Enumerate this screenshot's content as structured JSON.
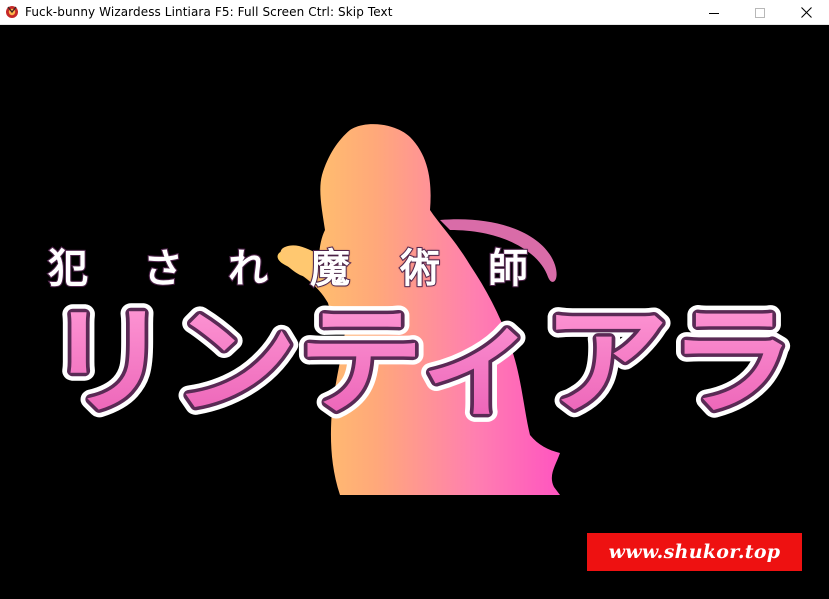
{
  "window": {
    "title": "Fuck-bunny Wizardess Lintiara F5: Full Screen Ctrl: Skip Text",
    "icon": "app-icon",
    "controls": {
      "minimize_icon": "minimize-icon",
      "maximize_icon": "maximize-icon",
      "close_icon": "close-icon"
    }
  },
  "game": {
    "subtitle": {
      "chars": [
        "犯",
        "さ",
        "れ",
        "魔",
        "術",
        "師"
      ]
    },
    "main_title": "リンティアラ",
    "watermark": "www.shukor.top"
  },
  "colors": {
    "title_bar_bg": "#ffffff",
    "game_bg": "#000000",
    "title_pink": "#f27fc6",
    "title_outline": "#5a2a55",
    "silhouette_left": "#ffc060",
    "silhouette_right": "#ff60b0",
    "watermark_bg": "#ee1111"
  }
}
